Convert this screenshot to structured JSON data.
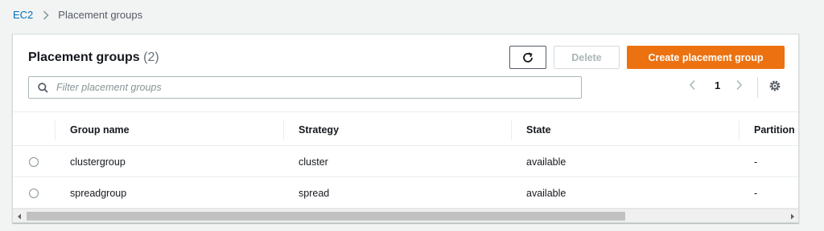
{
  "breadcrumb": {
    "root": "EC2",
    "current": "Placement groups"
  },
  "panel": {
    "title": "Placement groups",
    "count": "(2)"
  },
  "toolbar": {
    "refresh_icon": "refresh-icon",
    "delete_label": "Delete",
    "create_label": "Create placement group"
  },
  "search": {
    "placeholder": "Filter placement groups",
    "value": ""
  },
  "pagination": {
    "current_page": "1"
  },
  "table": {
    "columns": [
      "Group name",
      "Strategy",
      "State",
      "Partition"
    ],
    "rows": [
      {
        "name": "clustergroup",
        "strategy": "cluster",
        "state": "available",
        "partition": "-"
      },
      {
        "name": "spreadgroup",
        "strategy": "spread",
        "state": "available",
        "partition": "-"
      }
    ]
  },
  "colors": {
    "accent": "#ec7211",
    "link": "#0073bb",
    "background": "#f2f3f3"
  }
}
